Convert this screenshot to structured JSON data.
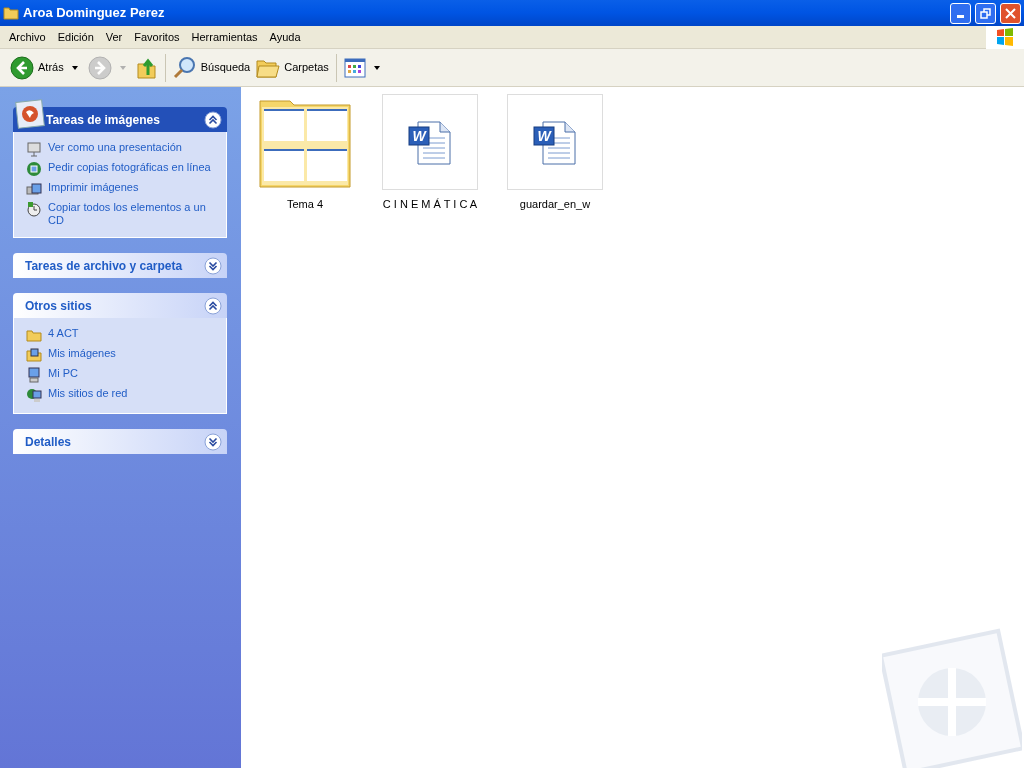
{
  "window": {
    "title": "Aroa Dominguez Perez"
  },
  "menu": [
    "Archivo",
    "Edición",
    "Ver",
    "Favoritos",
    "Herramientas",
    "Ayuda"
  ],
  "toolbar": [
    {
      "kind": "back",
      "label": "Atrás",
      "disabled": false
    },
    {
      "kind": "forward",
      "disabled": true
    },
    {
      "kind": "up",
      "disabled": false
    },
    {
      "kind": "search",
      "label": "Búsqueda",
      "disabled": false
    },
    {
      "kind": "folders",
      "label": "Carpetas",
      "disabled": false
    },
    {
      "kind": "views",
      "disabled": false
    }
  ],
  "panels": [
    {
      "kind": "special",
      "title": "Tareas de imágenes",
      "expanded": true,
      "items": [
        {
          "kind": "slideshow",
          "label": "Ver como una presentación"
        },
        {
          "kind": "order",
          "label": "Pedir copias fotográficas en línea"
        },
        {
          "kind": "print",
          "label": "Imprimir imágenes"
        },
        {
          "kind": "cd",
          "label": "Copiar todos los elementos a un CD"
        }
      ]
    },
    {
      "kind": "normal",
      "title": "Tareas de archivo y carpeta",
      "expanded": false
    },
    {
      "kind": "normal",
      "title": "Otros sitios",
      "expanded": true,
      "items": [
        {
          "kind": "folder",
          "label": "4 ACT"
        },
        {
          "kind": "pictures",
          "label": "Mis imágenes"
        },
        {
          "kind": "computer",
          "label": "Mi PC"
        },
        {
          "kind": "network",
          "label": "Mis sitios de red"
        }
      ]
    },
    {
      "kind": "normal",
      "title": "Detalles",
      "expanded": false
    }
  ],
  "files": [
    {
      "kind": "folder",
      "name": "Tema 4",
      "selected": false
    },
    {
      "kind": "document",
      "icon_letter": "W",
      "name": "C I N E M Á T I C A",
      "selected": false
    },
    {
      "kind": "document",
      "icon_letter": "W",
      "name": "guardar_en_w",
      "selected": false
    }
  ]
}
